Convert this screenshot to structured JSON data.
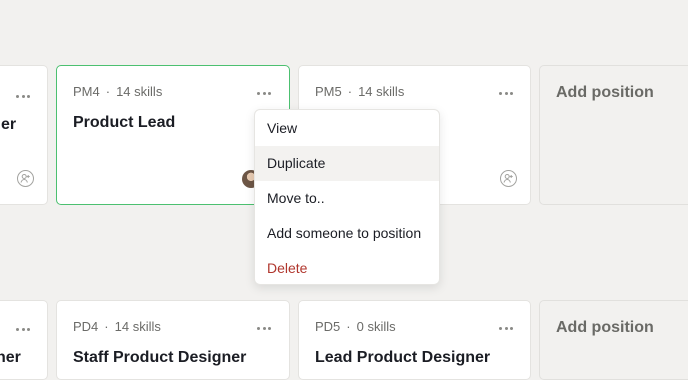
{
  "board": {
    "rows": [
      {
        "cards": [
          {
            "code": "",
            "skills": "",
            "title": "er",
            "partial": true
          },
          {
            "code": "PM4",
            "skills": "14 skills",
            "title": "Product Lead",
            "selected": true
          },
          {
            "code": "PM5",
            "skills": "14 skills",
            "title": ""
          },
          {
            "add_label": "Add position"
          }
        ]
      },
      {
        "cards": [
          {
            "code": "",
            "skills": "",
            "title": "ner",
            "partial": true
          },
          {
            "code": "PD4",
            "skills": "14 skills",
            "title": "Staff Product Designer"
          },
          {
            "code": "PD5",
            "skills": "0 skills",
            "title": "Lead Product Designer"
          },
          {
            "add_label": "Add position"
          }
        ]
      }
    ],
    "separator": "·"
  },
  "context_menu": {
    "items": [
      {
        "label": "View"
      },
      {
        "label": "Duplicate",
        "hovered": true
      },
      {
        "label": "Move to.."
      },
      {
        "label": "Add someone to position"
      },
      {
        "label": "Delete",
        "destructive": true,
        "color": "#b0362d"
      }
    ]
  },
  "colors": {
    "background": "#f2f1ef",
    "selected_border": "#4cc070",
    "danger": "#b0362d",
    "title": "#1b1d24"
  },
  "icons": {
    "more": "more-horizontal-icon",
    "add_person": "add-person-icon",
    "avatar": "avatar"
  }
}
